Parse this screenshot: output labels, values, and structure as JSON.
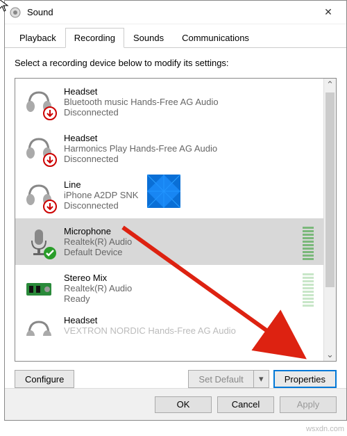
{
  "window": {
    "title": "Sound",
    "closeGlyph": "✕"
  },
  "tabs": {
    "items": [
      {
        "label": "Playback",
        "active": false
      },
      {
        "label": "Recording",
        "active": true
      },
      {
        "label": "Sounds",
        "active": false
      },
      {
        "label": "Communications",
        "active": false
      }
    ]
  },
  "instruction": "Select a recording device below to modify its settings:",
  "devices": [
    {
      "name": "Headset",
      "description": "Bluetooth music Hands-Free AG Audio",
      "status": "Disconnected",
      "icon": "headset",
      "badge": "down-red",
      "selected": false,
      "meter": null
    },
    {
      "name": "Headset",
      "description": "Harmonics Play Hands-Free AG Audio",
      "status": "Disconnected",
      "icon": "headset",
      "badge": "down-red",
      "selected": false,
      "meter": null
    },
    {
      "name": "Line",
      "description": "iPhone A2DP SNK",
      "status": "Disconnected",
      "icon": "headset",
      "badge": "down-red",
      "selected": false,
      "meter": null
    },
    {
      "name": "Microphone",
      "description": "Realtek(R) Audio",
      "status": "Default Device",
      "icon": "microphone",
      "badge": "check-green",
      "selected": true,
      "meter": "full"
    },
    {
      "name": "Stereo Mix",
      "description": "Realtek(R) Audio",
      "status": "Ready",
      "icon": "soundcard",
      "badge": null,
      "selected": false,
      "meter": "low"
    },
    {
      "name": "Headset",
      "description": "VEXTRON NORDIC Hands-Free AG Audio",
      "status": "",
      "icon": "headset",
      "badge": null,
      "selected": false,
      "meter": null
    }
  ],
  "buttons": {
    "configure": "Configure",
    "setDefault": "Set Default",
    "properties": "Properties",
    "ok": "OK",
    "cancel": "Cancel",
    "apply": "Apply",
    "chevronDown": "▾",
    "scrollUp": "⌃",
    "scrollDown": "⌄"
  },
  "watermark": "wsxdn.com"
}
